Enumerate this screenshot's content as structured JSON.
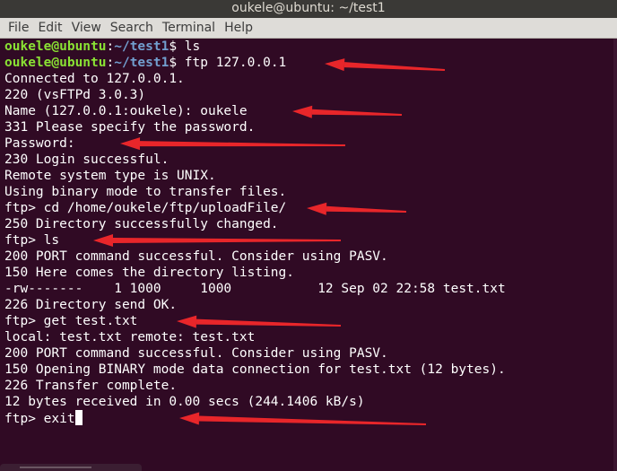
{
  "window": {
    "title": "oukele@ubuntu: ~/test1"
  },
  "menu": [
    "File",
    "Edit",
    "View",
    "Search",
    "Terminal",
    "Help"
  ],
  "prompt": {
    "user_host": "oukele@ubuntu",
    "colon": ":",
    "cwd": "~/test1",
    "symbol": "$ "
  },
  "terminal": {
    "lines": [
      {
        "type": "shell",
        "cmd": "ls"
      },
      {
        "type": "shell",
        "cmd": "ftp 127.0.0.1"
      },
      {
        "type": "out",
        "text": "Connected to 127.0.0.1."
      },
      {
        "type": "out",
        "text": "220 (vsFTPd 3.0.3)"
      },
      {
        "type": "out",
        "text": "Name (127.0.0.1:oukele): oukele"
      },
      {
        "type": "out",
        "text": "331 Please specify the password."
      },
      {
        "type": "out",
        "text": "Password:"
      },
      {
        "type": "out",
        "text": "230 Login successful."
      },
      {
        "type": "out",
        "text": "Remote system type is UNIX."
      },
      {
        "type": "out",
        "text": "Using binary mode to transfer files."
      },
      {
        "type": "out",
        "text": "ftp> cd /home/oukele/ftp/uploadFile/"
      },
      {
        "type": "out",
        "text": "250 Directory successfully changed."
      },
      {
        "type": "out",
        "text": "ftp> ls"
      },
      {
        "type": "out",
        "text": "200 PORT command successful. Consider using PASV."
      },
      {
        "type": "out",
        "text": "150 Here comes the directory listing."
      },
      {
        "type": "out",
        "text": "-rw-------    1 1000     1000           12 Sep 02 22:58 test.txt"
      },
      {
        "type": "out",
        "text": "226 Directory send OK."
      },
      {
        "type": "out",
        "text": "ftp> get test.txt"
      },
      {
        "type": "out",
        "text": "local: test.txt remote: test.txt"
      },
      {
        "type": "out",
        "text": "200 PORT command successful. Consider using PASV."
      },
      {
        "type": "out",
        "text": "150 Opening BINARY mode data connection for test.txt (12 bytes)."
      },
      {
        "type": "out",
        "text": "226 Transfer complete."
      },
      {
        "type": "out",
        "text": "12 bytes received in 0.00 secs (244.1406 kB/s)"
      },
      {
        "type": "input",
        "text": "ftp> exit"
      }
    ]
  },
  "annotation_arrows": {
    "color": "#e8262a",
    "count": 8
  }
}
